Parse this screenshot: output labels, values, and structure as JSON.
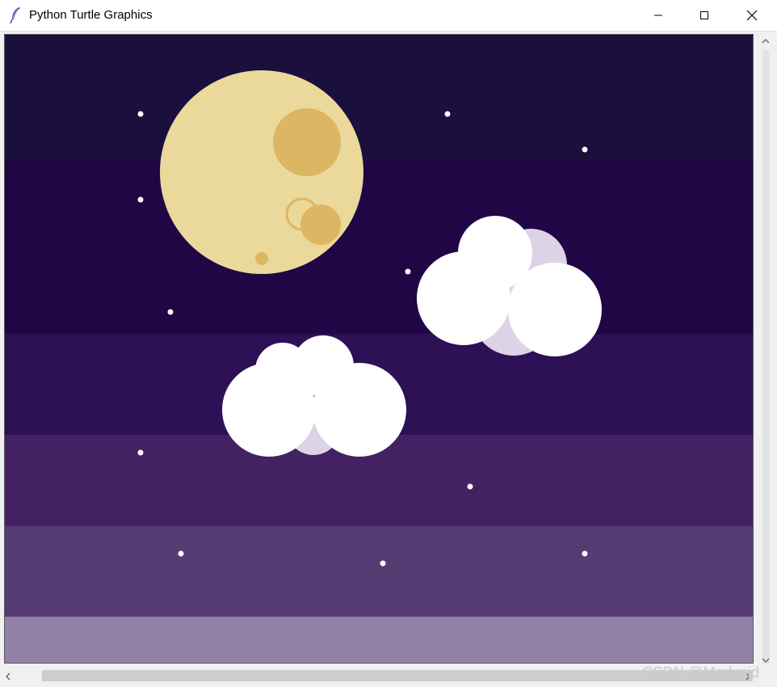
{
  "window": {
    "title": "Python Turtle Graphics",
    "icon": "feather-icon",
    "controls": [
      "minimize-icon",
      "maximize-icon",
      "close-icon"
    ]
  },
  "scene": {
    "sky_bands": [
      "#1a0f3d",
      "#200645",
      "#2e1057",
      "#432264",
      "#573b73",
      "#9181a6"
    ],
    "moon": {
      "color": "#ead99a",
      "crater_color": "#ddb663"
    },
    "cloud": {
      "color": "#ffffff",
      "shadow_color": "#dcd3e6"
    },
    "star_color": "#ffffff"
  },
  "scrollbars": {
    "vertical_up": "scroll-up-arrow",
    "vertical_down": "scroll-down-arrow",
    "horizontal_left": "scroll-left-arrow",
    "horizontal_right": "scroll-right-arrow"
  },
  "watermark": "CSDN @Morlvoid"
}
